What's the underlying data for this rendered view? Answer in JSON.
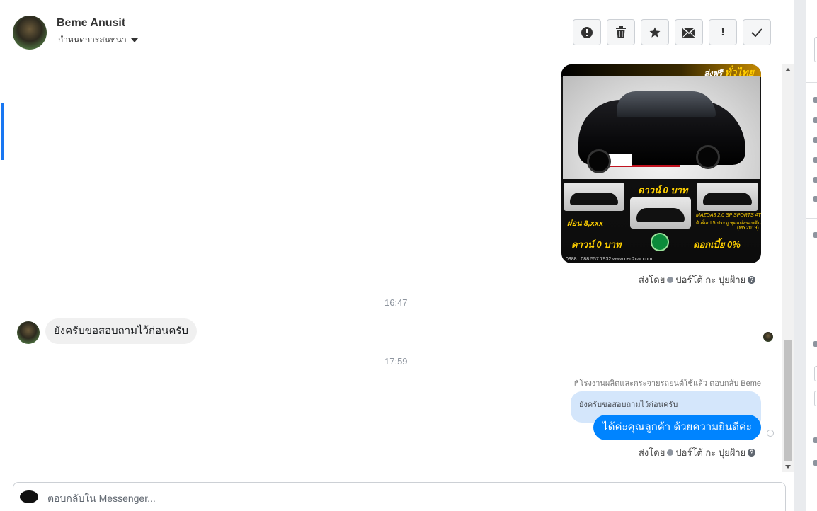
{
  "header": {
    "contact_name": "Beme Anusit",
    "assign_label": "กำหนดการสนทนา",
    "actions": [
      {
        "icon": "alert-circle-icon",
        "glyph": "!"
      },
      {
        "icon": "trash-icon",
        "glyph": "🗑"
      },
      {
        "icon": "star-icon",
        "glyph": "★"
      },
      {
        "icon": "envelope-icon",
        "glyph": "✉"
      },
      {
        "icon": "exclamation-icon",
        "glyph": "!"
      },
      {
        "icon": "checkmark-icon",
        "glyph": "✓"
      }
    ]
  },
  "ad_image": {
    "banner_prefix": "ส่งฟรี",
    "banner_highlight": "ทั่วไทย",
    "down_payment_top": "ดาวน์ 0 บาท",
    "installment": "ผ่อน 8,xxx",
    "down_payment_bottom": "ดาวน์ 0 บาท",
    "interest": "ดอกเบี้ย 0%",
    "model": "MAZDA3 2.0 SP SPORTS AT",
    "model_detail": "ตัวท็อป 5 ประตู ชุดแต่งรอบคัน",
    "model_year": "(MY2019)",
    "contact_line": "0988 : 088 557 7932  www.cec2car.com"
  },
  "messages": {
    "sent_by_label": "ส่งโดย",
    "sent_by_name": "ปอร์โต้ กะ ปุยฝ้าย",
    "time_1": "16:47",
    "incoming_text": "ยังครับขอสอบถามไว้ก่อนครับ",
    "time_2": "17:59",
    "reply_note": "โรงงานผลิตและกระจายรถยนต์ใช้แล้ว ตอบกลับ Beme",
    "quoted_text": "ยังครับขอสอบถามไว้ก่อนครับ",
    "outgoing_text": "ได้ค่ะคุณลูกค้า ด้วยความยินดีค่ะ"
  },
  "composer": {
    "placeholder": "ตอบกลับใน Messenger..."
  },
  "colors": {
    "accent": "#1877f2",
    "outgoing_bubble": "#0084ff",
    "incoming_bubble": "#f0f0f0",
    "quoted_bubble": "#d4e6fb"
  }
}
